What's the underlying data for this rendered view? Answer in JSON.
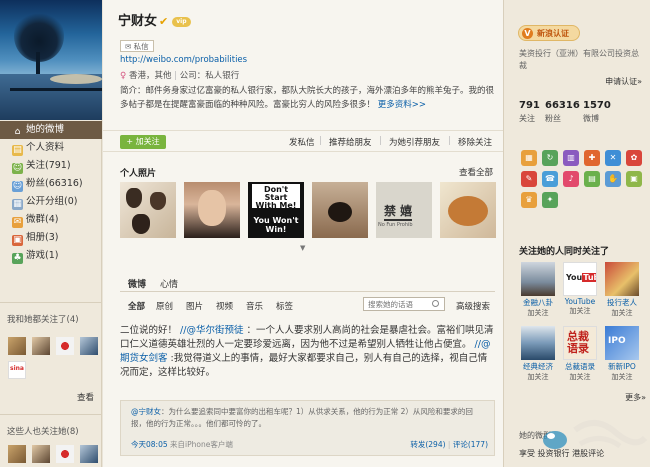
{
  "profile": {
    "name": "宁财女",
    "vip_badge": "vip",
    "message_btn": "私信",
    "url": "http://weibo.com/probabilities",
    "gender_icon": "♀",
    "location": "香港，其他",
    "company": "公司：私人银行",
    "intro": "简介：邮件务身家过亿富豪的私人银行家，都队大院长大的孩子，海外漂泊多年的熊羊兔子。我的很多帖子都是在提醒富豪面临的种种风险。富豪比穷人的风险多很多！",
    "intro_more": "更多资料>>"
  },
  "actions": {
    "follow": "+ 加关注",
    "send_msg": "发私信",
    "recommend": "推荐给朋友",
    "group": "为她引荐朋友",
    "remove": "移除关注"
  },
  "photos": {
    "title": "个人照片",
    "see_all": "查看全部",
    "p3_lines": [
      "Don't",
      "Start",
      "With Me!",
      "You Won't",
      "Win!"
    ],
    "p5_char": "禁 嬉",
    "p5_sub": "No Fun Prohib"
  },
  "tabs": [
    "微博",
    "心情"
  ],
  "filters": [
    "全部",
    "原创",
    "图片",
    "视频",
    "音乐",
    "标签"
  ],
  "search": {
    "placeholder": "搜索她的话语",
    "advanced": "高级搜索"
  },
  "post": {
    "text": "二位说的好！",
    "mention1": "//@华尔街预徒",
    "text2": "：一个人人要求别人高尚的社会是暴虐社会。富裕们哄见清口仁义道德英雄壮烈的人一定要珍爱远离，因为他不过是希望别人牺牲让他占便宜。",
    "mention2": "//@期货女剑客",
    "text3": ":我觉得道义上的事情，最好大家都要求自己，别人有自己的选择，视自己情况而定，这样比较好。"
  },
  "quote": {
    "author": "@宁财女",
    "text": "：为什么要追索同中要富你的出租车呢？1）从供求关系，他的行为正常 2）从风险和要求的回报，他的行为正常。。。他们都可怜的了。",
    "time": "今天08:05",
    "source": "来自iPhone客户端",
    "repost": "转发(294)",
    "comment": "评论(177)"
  },
  "left_nav": [
    {
      "label": "她的微博",
      "icon": "home-icon",
      "glyph": "⌂",
      "cls": ""
    },
    {
      "label": "个人资料",
      "icon": "profile-icon",
      "glyph": "▤",
      "cls": "ico-doc"
    },
    {
      "label": "关注(791)",
      "icon": "following-icon",
      "glyph": "☺",
      "cls": "ico-follow"
    },
    {
      "label": "粉丝(66316)",
      "icon": "fans-icon",
      "glyph": "☺",
      "cls": "ico-fans"
    },
    {
      "label": "公开分组(0)",
      "icon": "group-icon",
      "glyph": "▦",
      "cls": "ico-group"
    },
    {
      "label": "微群(4)",
      "icon": "weiqun-icon",
      "glyph": "✉",
      "cls": "ico-micro"
    },
    {
      "label": "相册(3)",
      "icon": "album-icon",
      "glyph": "▣",
      "cls": "ico-album"
    },
    {
      "label": "游戏(1)",
      "icon": "game-icon",
      "glyph": "♣",
      "cls": "ico-game"
    }
  ],
  "left_sections": {
    "mutual_title": "我和她都关注了(4)",
    "see_all": "查看",
    "bottom_title": "这些人也关注她(8)"
  },
  "right": {
    "cert_label": "新浪认证",
    "cert_info": "美资投行（亚洲）有限公司投资总裁",
    "apply": "申请认证»",
    "stats": [
      {
        "num": "791",
        "label": "关注"
      },
      {
        "num": "66316",
        "label": "粉丝"
      },
      {
        "num": "1570",
        "label": "微博"
      }
    ],
    "fof_title": "关注她的人同时关注了",
    "follow_label": "加关注",
    "more": "更多»",
    "fof": [
      {
        "name": "金融八卦"
      },
      {
        "name": "YouTube"
      },
      {
        "name": "投行老人"
      },
      {
        "name": "经典经济"
      },
      {
        "name": "总裁语录"
      },
      {
        "name": "新新IPO"
      }
    ],
    "bottom_title": "她的微群",
    "bottom_row": "享受  投资银行  港股评论"
  },
  "colors": {
    "accent_link": "#0a5fa8",
    "follow_green": "#79b43e",
    "sidebar_bg": "#efe9dc",
    "active_nav": "#6d5a44"
  }
}
